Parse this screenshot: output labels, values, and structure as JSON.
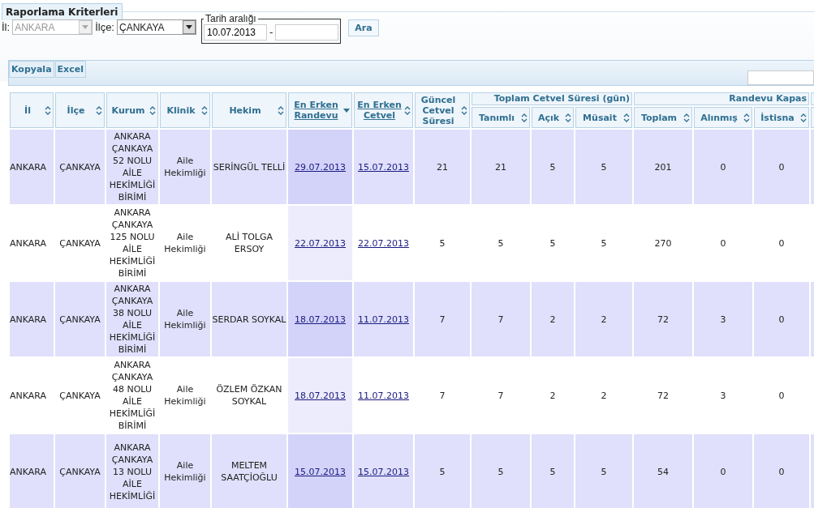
{
  "criteria": {
    "title": "Raporlama Kriterleri",
    "il": {
      "label": "İl:",
      "value": "ANKARA",
      "disabled": true
    },
    "ilce": {
      "label": "İlçe:",
      "value": "ÇANKAYA",
      "disabled": false
    },
    "date_range": {
      "legend": "Tarih aralığı",
      "start": "10.07.2013",
      "separator": "-"
    },
    "search_button": "Ara"
  },
  "toolbar": {
    "buttons": [
      "Kopyala",
      "Excel"
    ]
  },
  "table": {
    "columns": [
      {
        "kind": "column",
        "label": "İl",
        "sorted": false,
        "link": false
      },
      {
        "kind": "column",
        "label": "İlçe",
        "sorted": false,
        "link": false
      },
      {
        "kind": "column",
        "label": "Kurum",
        "sorted": false,
        "link": false
      },
      {
        "kind": "column",
        "label": "Klinik",
        "sorted": false,
        "link": false
      },
      {
        "kind": "column",
        "label": "Hekim",
        "sorted": false,
        "link": false
      },
      {
        "kind": "column",
        "label": "En Erken Randevu",
        "sorted": true,
        "link": true
      },
      {
        "kind": "column",
        "label": "En Erken Cetvel",
        "sorted": false,
        "link": true
      },
      {
        "kind": "column",
        "label": "Güncel Cetvel Süresi",
        "sorted": false,
        "link": false
      },
      {
        "kind": "grouped",
        "group_label": "Toplam Cetvel Süresi (gün)",
        "label": "Tanımlı",
        "sorted": false,
        "link": false
      },
      {
        "kind": "grouped",
        "label": "Açık",
        "sorted": false,
        "link": false
      },
      {
        "kind": "grouped",
        "label": "Müsait",
        "sorted": false,
        "link": false
      },
      {
        "kind": "grouped",
        "group_label": "Randevu Kapas",
        "label": "Toplam",
        "sorted": false,
        "link": false
      },
      {
        "kind": "grouped",
        "label": "Alınmış",
        "sorted": false,
        "link": false
      },
      {
        "kind": "grouped",
        "label": "İstisna",
        "sorted": false,
        "link": false
      }
    ],
    "rows": [
      [
        "ANKARA",
        "ÇANKAYA",
        "ANKARA ÇANKAYA 52 NOLU AİLE HEKİMLİĞİ BİRİMİ",
        "Aile Hekimliği",
        "SERİNGÜL TELLİ",
        "29.07.2013",
        "15.07.2013",
        "21",
        "21",
        "5",
        "5",
        "201",
        "0",
        "0"
      ],
      [
        "ANKARA",
        "ÇANKAYA",
        "ANKARA ÇANKAYA 125 NOLU AİLE HEKİMLİĞİ BİRİMİ",
        "Aile Hekimliği",
        "ALİ TOLGA ERSOY",
        "22.07.2013",
        "22.07.2013",
        "5",
        "5",
        "5",
        "5",
        "270",
        "0",
        "0"
      ],
      [
        "ANKARA",
        "ÇANKAYA",
        "ANKARA ÇANKAYA 38 NOLU AİLE HEKİMLİĞİ BİRİMİ",
        "Aile Hekimliği",
        "SERDAR SOYKAL",
        "18.07.2013",
        "11.07.2013",
        "7",
        "7",
        "2",
        "2",
        "72",
        "3",
        "0"
      ],
      [
        "ANKARA",
        "ÇANKAYA",
        "ANKARA ÇANKAYA 48 NOLU AİLE HEKİMLİĞİ BİRİMİ",
        "Aile Hekimliği",
        "ÖZLEM ÖZKAN SOYKAL",
        "18.07.2013",
        "11.07.2013",
        "7",
        "7",
        "2",
        "2",
        "72",
        "3",
        "0"
      ],
      [
        "ANKARA",
        "ÇANKAYA",
        "ANKARA ÇANKAYA 13 NOLU AİLE HEKİMLİĞİ",
        "Aile Hekimliği",
        "MELTEM SAATÇİOĞLU",
        "15.07.2013",
        "15.07.2013",
        "5",
        "5",
        "5",
        "5",
        "54",
        "0",
        "0"
      ]
    ]
  }
}
